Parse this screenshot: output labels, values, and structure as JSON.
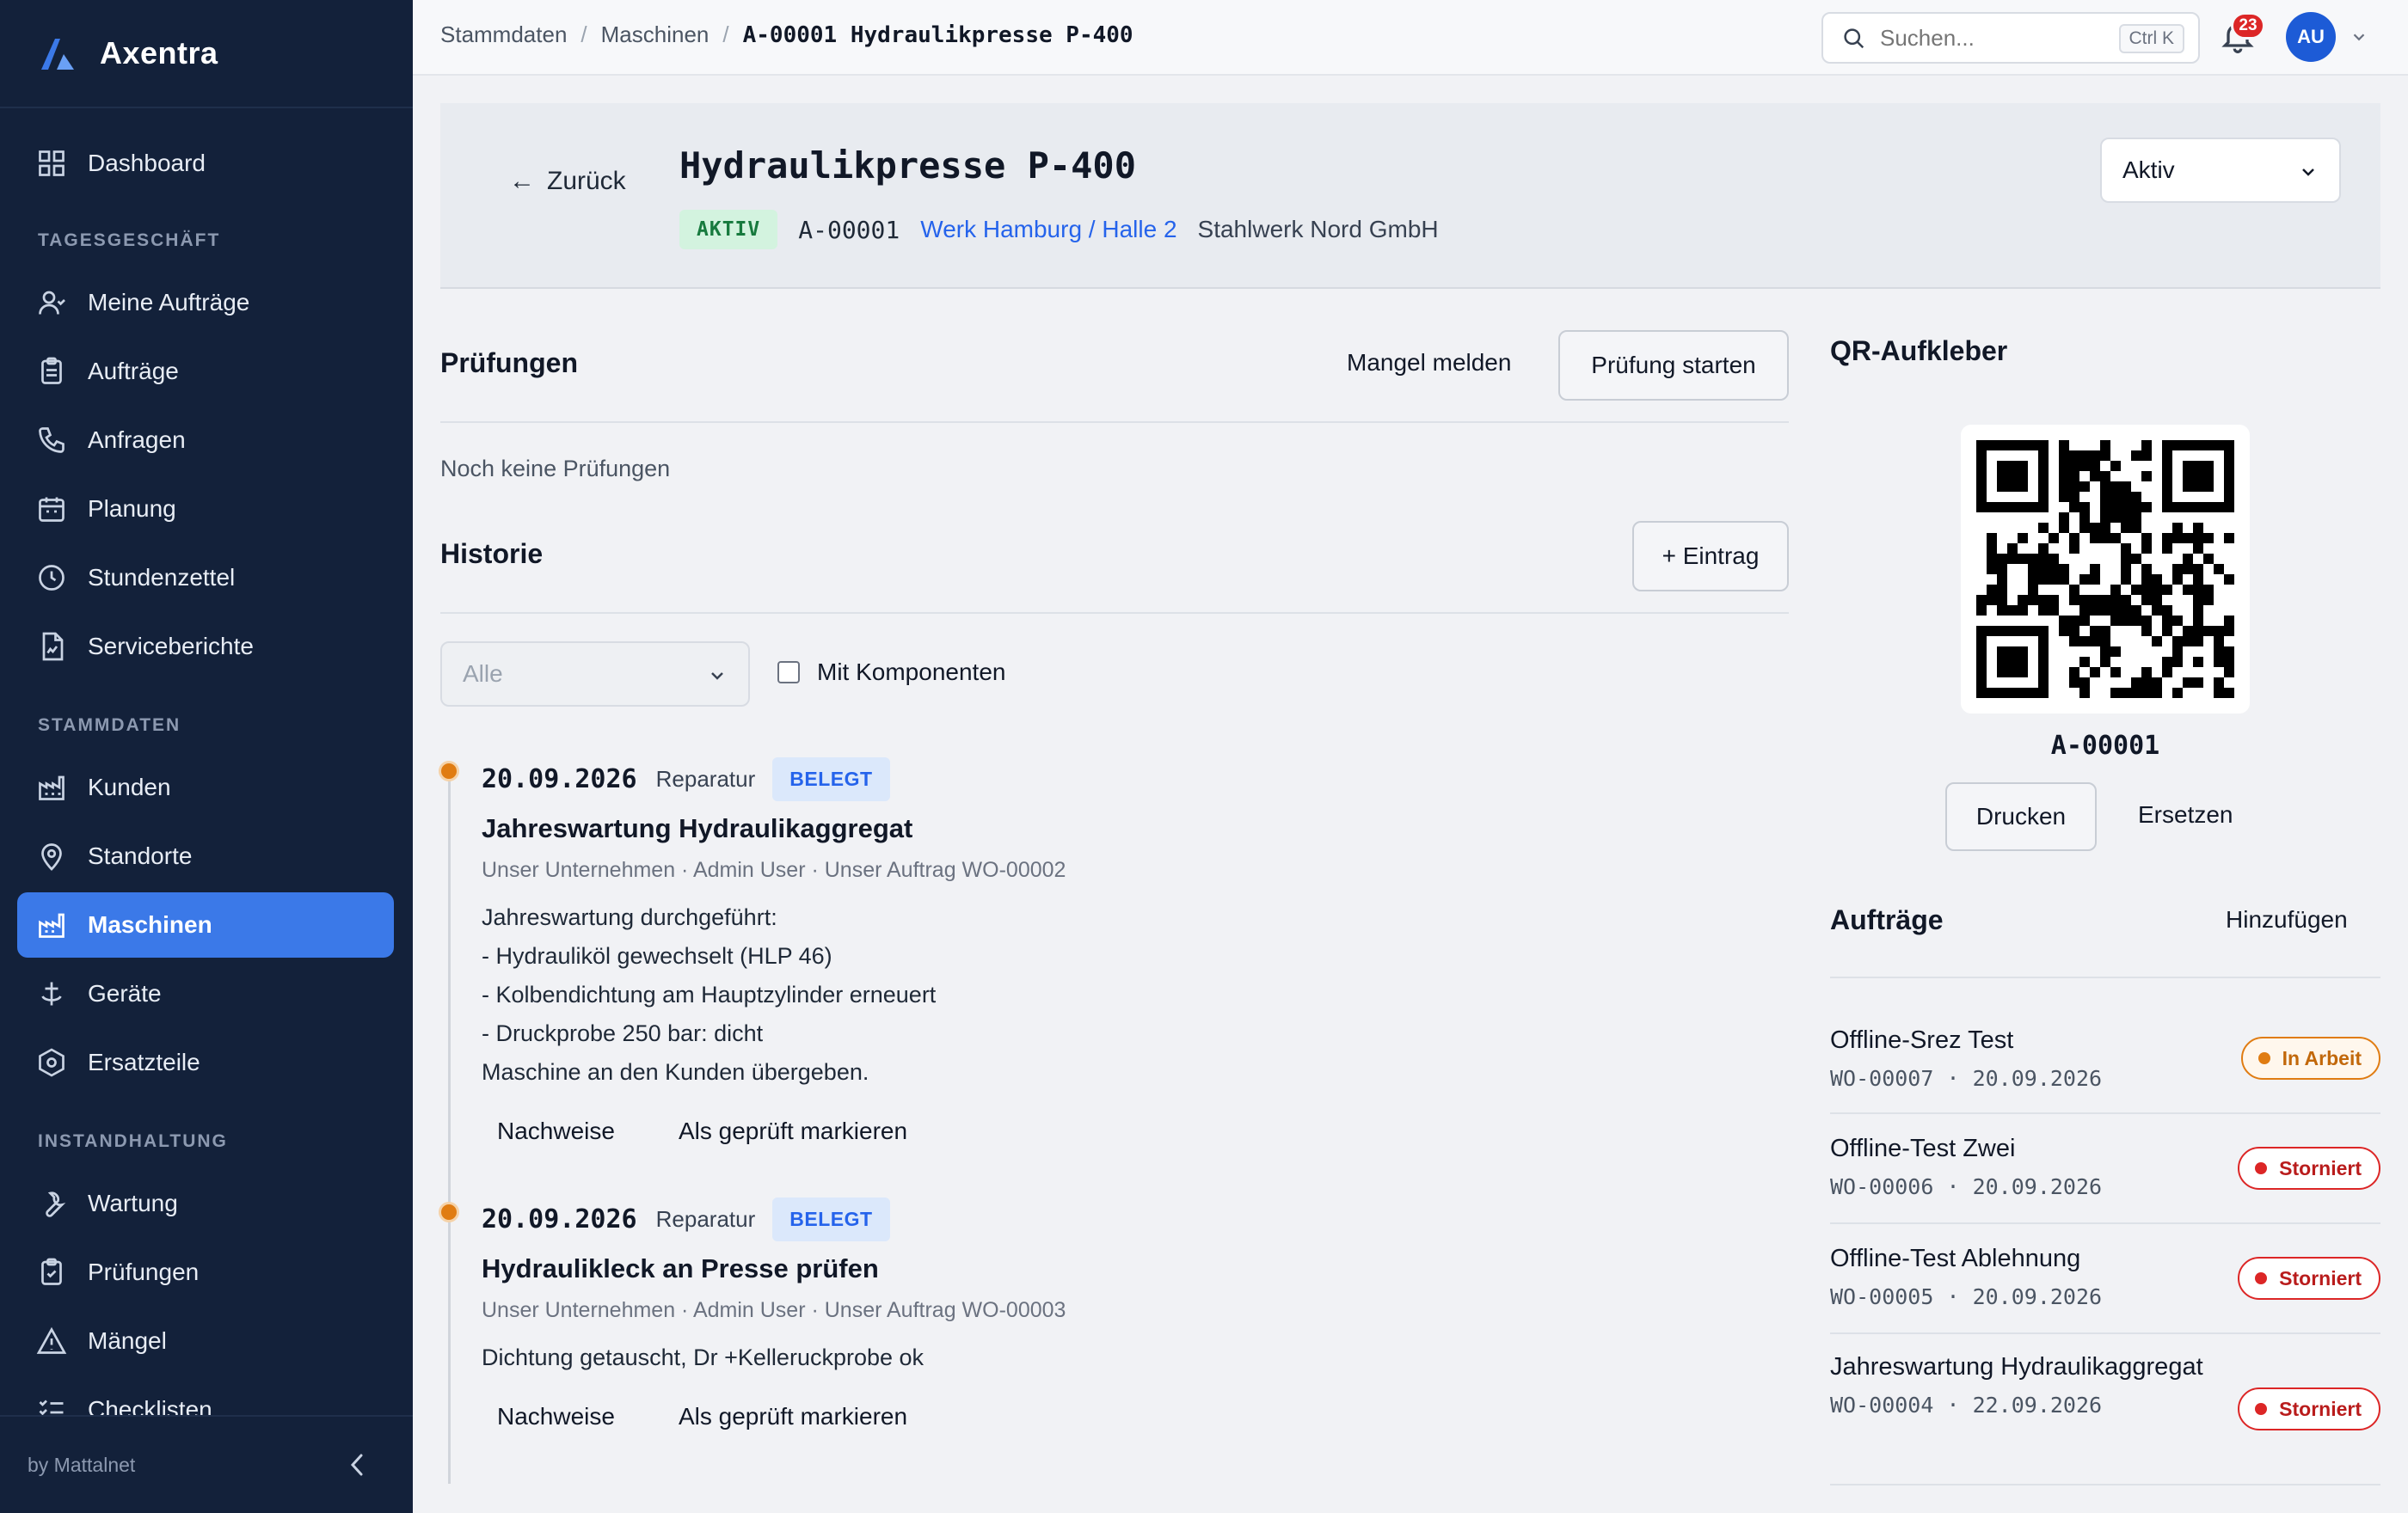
{
  "app": {
    "name": "Axentra"
  },
  "sidebar": {
    "items_top": [
      {
        "label": "Dashboard",
        "icon": "grid-icon"
      }
    ],
    "sections": [
      {
        "title": "TAGESGESCHÄFT",
        "items": [
          {
            "label": "Meine Aufträge",
            "icon": "user-icon"
          },
          {
            "label": "Aufträge",
            "icon": "clipboard-icon"
          },
          {
            "label": "Anfragen",
            "icon": "phone-icon"
          },
          {
            "label": "Planung",
            "icon": "calendar-icon"
          },
          {
            "label": "Stundenzettel",
            "icon": "clock-icon"
          },
          {
            "label": "Serviceberichte",
            "icon": "report-icon"
          }
        ]
      },
      {
        "title": "STAMMDATEN",
        "items": [
          {
            "label": "Kunden",
            "icon": "factory-icon"
          },
          {
            "label": "Standorte",
            "icon": "map-pin-icon"
          },
          {
            "label": "Maschinen",
            "icon": "machine-icon",
            "active": true
          },
          {
            "label": "Geräte",
            "icon": "tool-anchor-icon"
          },
          {
            "label": "Ersatzteile",
            "icon": "hex-bolt-icon"
          }
        ]
      },
      {
        "title": "INSTANDHALTUNG",
        "items": [
          {
            "label": "Wartung",
            "icon": "wrench-icon"
          },
          {
            "label": "Prüfungen",
            "icon": "clipboard-check-icon"
          },
          {
            "label": "Mängel",
            "icon": "warning-icon"
          },
          {
            "label": "Checklisten",
            "icon": "list-check-icon"
          }
        ]
      }
    ],
    "footer_text": "by Mattalnet"
  },
  "topbar": {
    "breadcrumbs": [
      "Stammdaten",
      "Maschinen",
      "A-00001 Hydraulikpresse P-400"
    ],
    "search_placeholder": "Suchen...",
    "search_shortcut": "Ctrl K",
    "notification_count": "23",
    "avatar_initials": "AU"
  },
  "machine": {
    "back_label": "Zurück",
    "title": "Hydraulikpresse P-400",
    "status_badge": "AKTIV",
    "id": "A-00001",
    "location": "Werk Hamburg / Halle 2",
    "customer": "Stahlwerk Nord GmbH",
    "status_select": "Aktiv"
  },
  "inspections": {
    "title": "Prüfungen",
    "report_defect": "Mangel melden",
    "start_inspection": "Prüfung starten",
    "empty_text": "Noch keine Prüfungen"
  },
  "history": {
    "title": "Historie",
    "add_entry": "+ Eintrag",
    "filter_value": "Alle",
    "with_components": "Mit Komponenten",
    "entries": [
      {
        "date": "20.09.2026",
        "type": "Reparatur",
        "badge": "BELEGT",
        "title": "Jahreswartung Hydraulikaggregat",
        "subtitle": "Unser Unternehmen · Admin User · Unser Auftrag WO-00002",
        "body": [
          "Jahreswartung durchgeführt:",
          "- Hydrauliköl gewechselt (HLP 46)",
          "- Kolbendichtung am Hauptzylinder erneuert",
          "- Druckprobe 250 bar: dicht",
          "Maschine an den Kunden übergeben."
        ],
        "action_evidence": "Nachweise",
        "action_verify": "Als geprüft markieren"
      },
      {
        "date": "20.09.2026",
        "type": "Reparatur",
        "badge": "BELEGT",
        "title": "Hydraulikleck an Presse prüfen",
        "subtitle": "Unser Unternehmen · Admin User · Unser Auftrag WO-00003",
        "body": [
          "Dichtung getauscht, Dr +Kelleruckprobe ok"
        ],
        "action_evidence": "Nachweise",
        "action_verify": "Als geprüft markieren"
      }
    ]
  },
  "qr": {
    "title": "QR-Aufkleber",
    "code": "A-00001",
    "print": "Drucken",
    "replace": "Ersetzen"
  },
  "orders": {
    "title": "Aufträge",
    "add": "Hinzufügen",
    "items": [
      {
        "title": "Offline-Srez Test",
        "sub": "WO-00007 · 20.09.2026",
        "status": "In Arbeit",
        "tone": "orange"
      },
      {
        "title": "Offline-Test Zwei",
        "sub": "WO-00006 · 20.09.2026",
        "status": "Storniert",
        "tone": "red"
      },
      {
        "title": "Offline-Test Ablehnung",
        "sub": "WO-00005 · 20.09.2026",
        "status": "Storniert",
        "tone": "red"
      },
      {
        "title": "Jahreswartung Hydraulikaggregat",
        "sub": "WO-00004 · 22.09.2026",
        "status": "Storniert",
        "tone": "red"
      }
    ]
  },
  "colors": {
    "sidebar_bg": "#13213a",
    "accent": "#3b79e8",
    "status_green": "#177a3e",
    "status_red": "#dc2626",
    "status_orange": "#e07c12"
  }
}
